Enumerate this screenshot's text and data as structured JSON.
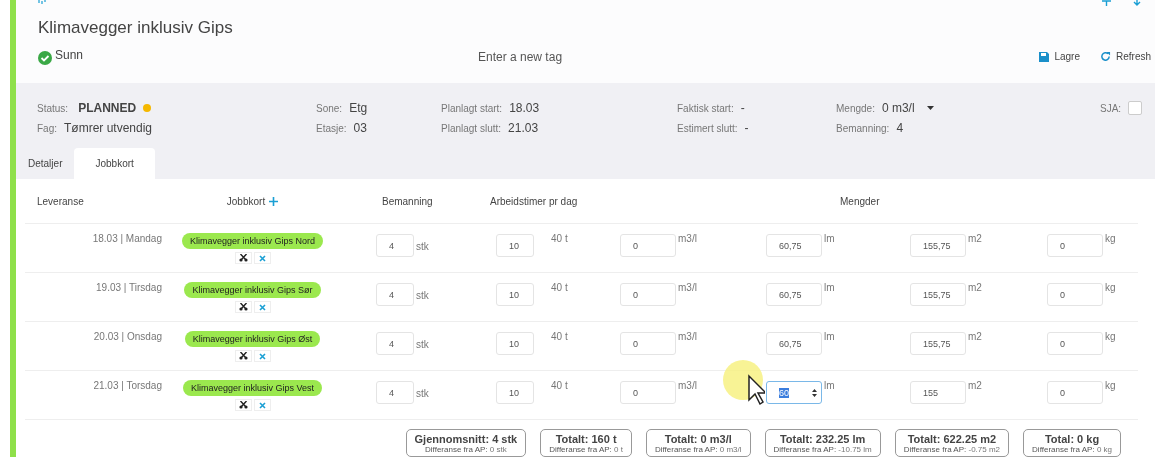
{
  "header": {
    "title": "Klimavegger inklusiv Gips",
    "health": "Sunn",
    "tag_input": {
      "placeholder": "Enter a new tag"
    },
    "actions": [
      {
        "kind": "save",
        "label": "Lagre"
      },
      {
        "kind": "refresh",
        "label": "Refresh"
      }
    ]
  },
  "info": {
    "status": {
      "label": "Status:",
      "value": "PLANNED"
    },
    "fag": {
      "label": "Fag:",
      "value": "Tømrer utvendig"
    },
    "sone": {
      "label": "Sone:",
      "value": "Etg"
    },
    "etasje": {
      "label": "Etasje:",
      "value": "03"
    },
    "planlagt_start": {
      "label": "Planlagt start:",
      "value": "18.03"
    },
    "planlagt_slutt": {
      "label": "Planlagt slutt:",
      "value": "21.03"
    },
    "faktisk_start": {
      "label": "Faktisk start:",
      "value": "-"
    },
    "estimert_slutt": {
      "label": "Estimert slutt:",
      "value": "-"
    },
    "mengde": {
      "label": "Mengde:",
      "value": "0 m3/l"
    },
    "bemanning": {
      "label": "Bemanning:",
      "value": "4"
    },
    "sja": {
      "label": "SJA:",
      "checked": false
    }
  },
  "tabs": [
    {
      "label": "Detaljer",
      "selected": false
    },
    {
      "label": "Jobbkort",
      "selected": true
    }
  ],
  "table": {
    "columns": [
      "Leveranse",
      "Jobbkort",
      "Bemanning",
      "Arbeidstimer pr dag",
      "Mengder"
    ],
    "rows": [
      {
        "date": "18.03 | Mandag",
        "jobcard": "Klimavegger inklusiv Gips Nord",
        "bemanning": "4",
        "bemanning_unit": "stk",
        "hours": "10",
        "hours_total": "40 t",
        "quantities": [
          {
            "value": "0",
            "unit": "m3/l",
            "focused": false
          },
          {
            "value": "60,75",
            "unit": "lm",
            "focused": false
          },
          {
            "value": "155,75",
            "unit": "m2",
            "focused": false
          },
          {
            "value": "0",
            "unit": "kg",
            "focused": false
          }
        ]
      },
      {
        "date": "19.03 | Tirsdag",
        "jobcard": "Klimavegger inklusiv Gips Sør",
        "bemanning": "4",
        "bemanning_unit": "stk",
        "hours": "10",
        "hours_total": "40 t",
        "quantities": [
          {
            "value": "0",
            "unit": "m3/l",
            "focused": false
          },
          {
            "value": "60,75",
            "unit": "lm",
            "focused": false
          },
          {
            "value": "155,75",
            "unit": "m2",
            "focused": false
          },
          {
            "value": "0",
            "unit": "kg",
            "focused": false
          }
        ]
      },
      {
        "date": "20.03 | Onsdag",
        "jobcard": "Klimavegger inklusiv Gips Øst",
        "bemanning": "4",
        "bemanning_unit": "stk",
        "hours": "10",
        "hours_total": "40 t",
        "quantities": [
          {
            "value": "0",
            "unit": "m3/l",
            "focused": false
          },
          {
            "value": "60,75",
            "unit": "lm",
            "focused": false
          },
          {
            "value": "155,75",
            "unit": "m2",
            "focused": false
          },
          {
            "value": "0",
            "unit": "kg",
            "focused": false
          }
        ]
      },
      {
        "date": "21.03 | Torsdag",
        "jobcard": "Klimavegger inklusiv Gips Vest",
        "bemanning": "4",
        "bemanning_unit": "stk",
        "hours": "10",
        "hours_total": "40 t",
        "quantities": [
          {
            "value": "0",
            "unit": "m3/l",
            "focused": false
          },
          {
            "value": "60",
            "unit": "lm",
            "focused": true
          },
          {
            "value": "155",
            "unit": "m2",
            "focused": false
          },
          {
            "value": "0",
            "unit": "kg",
            "focused": false
          }
        ]
      }
    ]
  },
  "totals": [
    {
      "title": "Gjennomsnitt: 4 stk",
      "diff_label": "Differanse fra AP:",
      "diff": "0 stk"
    },
    {
      "title": "Totalt: 160 t",
      "diff_label": "Differanse fra AP:",
      "diff": "0 t"
    },
    {
      "title": "Totalt: 0 m3/l",
      "diff_label": "Differanse fra AP:",
      "diff": "0 m3/l"
    },
    {
      "title": "Totalt: 232.25 lm",
      "diff_label": "Differanse fra AP:",
      "diff": "-10.75 lm"
    },
    {
      "title": "Totalt: 622.25 m2",
      "diff_label": "Differanse fra AP:",
      "diff": "-0.75 m2"
    },
    {
      "title": "Total: 0 kg",
      "diff_label": "Differanse fra AP:",
      "diff": "0 kg"
    }
  ]
}
